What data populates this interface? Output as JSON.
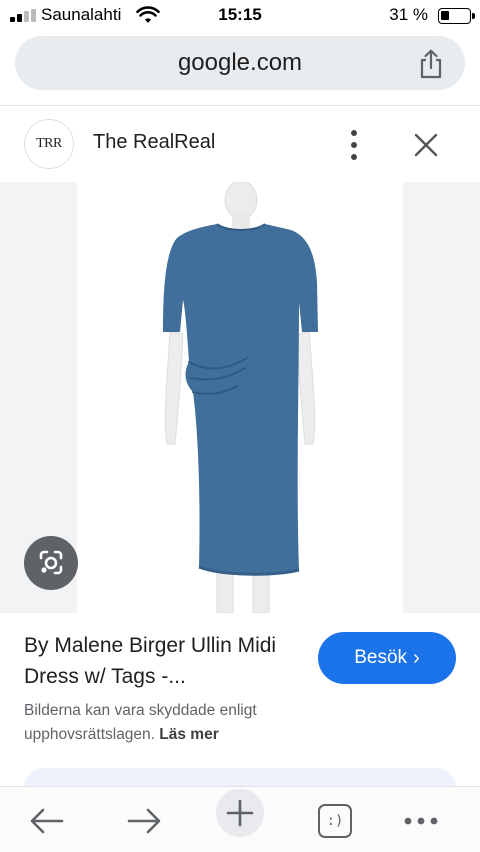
{
  "status_bar": {
    "carrier": "Saunalahti",
    "time": "15:15",
    "battery_percent": "31 %",
    "battery_level": 0.31
  },
  "browser": {
    "url": "google.com",
    "tabs_label": ":)"
  },
  "source": {
    "logo_text": "TRR",
    "name": "The RealReal"
  },
  "result": {
    "title": "By Malene Birger Ullin Midi Dress w/ Tags -...",
    "visit_label": "Besök",
    "copyright_text": "Bilderna kan vara skyddade enligt upphovsrättslagen.",
    "learn_more": "Läs mer"
  },
  "colors": {
    "accent": "#1a73e8",
    "dress": "#3f6f9a",
    "panel": "#f1f3f4"
  },
  "icons": [
    "signal-icon",
    "wifi-icon",
    "battery-icon",
    "share-icon",
    "more-vert-icon",
    "close-icon",
    "lens-icon",
    "back-icon",
    "forward-icon",
    "plus-icon",
    "tabs-icon",
    "more-horiz-icon"
  ]
}
